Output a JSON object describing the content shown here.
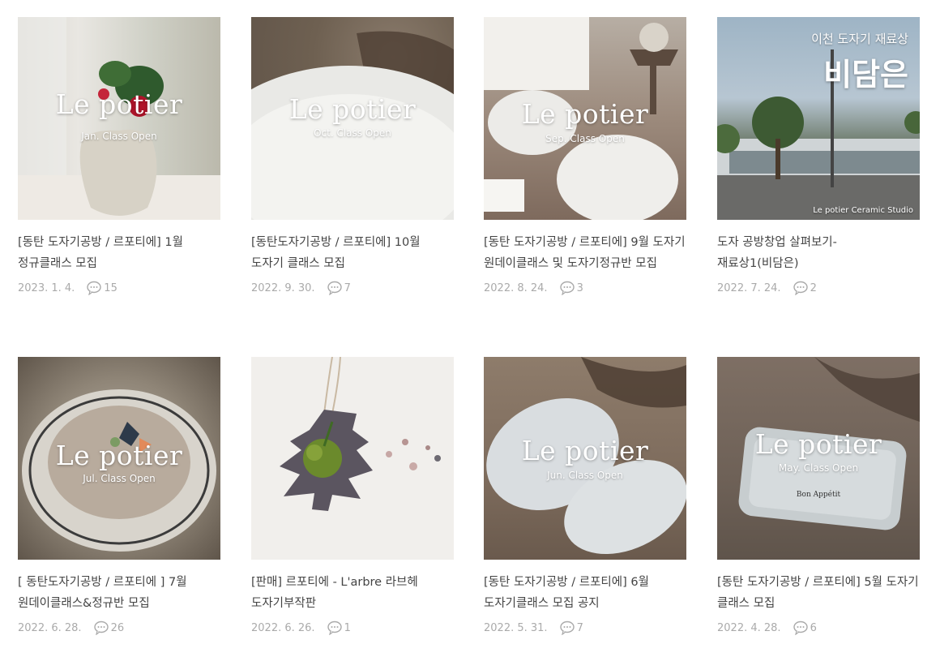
{
  "posts": [
    {
      "overlay_title": "Le potier",
      "overlay_sub": "Jan. Class Open",
      "title": "[동탄 도자기공방 / 르포티에] 1월 정규클래스 모집",
      "date": "2023. 1. 4.",
      "comments": "15"
    },
    {
      "overlay_title": "Le potier",
      "overlay_sub": "Oct. Class Open",
      "title": "[동탄도자기공방 / 르포티에] 10월 도자기 클래스 모집",
      "date": "2022. 9. 30.",
      "comments": "7"
    },
    {
      "overlay_title": "Le potier",
      "overlay_sub": "Sep. Class Open",
      "title": "[동탄 도자기공방 / 르포티에] 9월 도자기 원데이클래스 및 도자기정규반 모집",
      "date": "2022. 8. 24.",
      "comments": "3"
    },
    {
      "store_small": "이천 도자기 재료상",
      "store_big": "비담은",
      "corner_label": "Le potier Ceramic Studio",
      "title": "도자 공방창업 살펴보기- 재료상1(비담은)",
      "date": "2022. 7. 24.",
      "comments": "2"
    },
    {
      "overlay_title": "Le potier",
      "overlay_sub": "Jul. Class Open",
      "title": "[ 동탄도자기공방 / 르포티에 ] 7월 원데이클래스&정규반 모집",
      "date": "2022. 6. 28.",
      "comments": "26"
    },
    {
      "title": "[판매] 르포티에 - L'arbre 라브헤 도자기부작판",
      "date": "2022. 6. 26.",
      "comments": "1"
    },
    {
      "overlay_title": "Le potier",
      "overlay_sub": "Jun. Class Open",
      "title": "[동탄 도자기공방 / 르포티에] 6월 도자기클래스 모집 공지",
      "date": "2022. 5. 31.",
      "comments": "7"
    },
    {
      "overlay_title": "Le potier",
      "overlay_sub": "May. Class Open",
      "plate_text": "Bon Appétit",
      "title": "[동탄 도자기공방 / 르포티에] 5월 도자기 클래스 모집",
      "date": "2022. 4. 28.",
      "comments": "6"
    }
  ],
  "icons": {
    "comment": "comment-bubble-icon"
  },
  "colors": {
    "meta_text": "#aaaaaa",
    "title_text": "#444444"
  }
}
